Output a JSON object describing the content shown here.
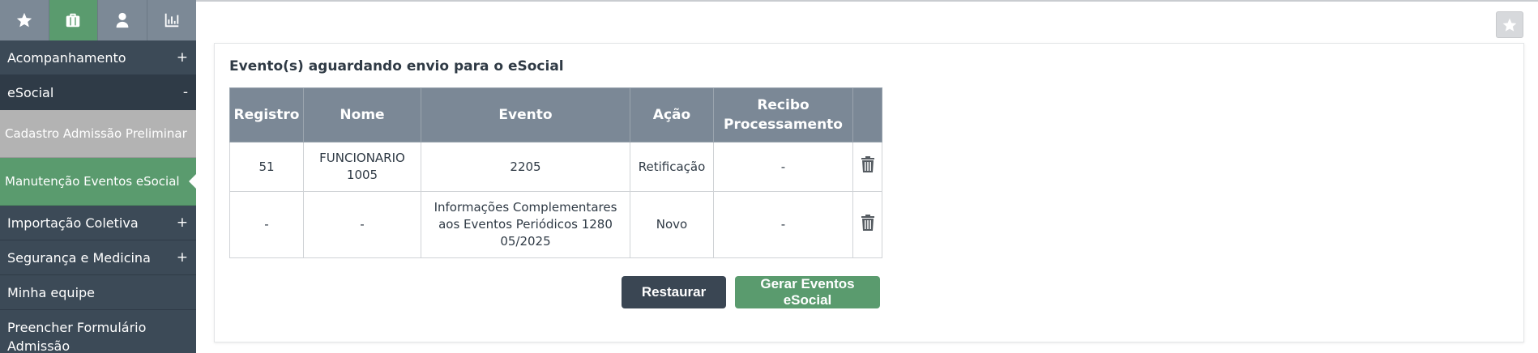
{
  "sidebar": {
    "tabs": [
      {
        "icon": "star-icon",
        "active": false
      },
      {
        "icon": "briefcase-icon",
        "active": true
      },
      {
        "icon": "user-icon",
        "active": false
      },
      {
        "icon": "bar-chart-icon",
        "active": false
      }
    ],
    "items": [
      {
        "label": "Acompanhamento",
        "sign": "+"
      },
      {
        "label": "eSocial",
        "sign": "-"
      },
      {
        "label": "Cadastro Admissão Preliminar"
      },
      {
        "label": "Manutenção Eventos eSocial"
      },
      {
        "label": "Importação Coletiva",
        "sign": "+"
      },
      {
        "label": "Segurança e Medicina",
        "sign": "+"
      },
      {
        "label": "Minha equipe"
      },
      {
        "label": "Preencher Formulário Admissão"
      }
    ]
  },
  "panel": {
    "title": "Evento(s) aguardando envio para o eSocial",
    "columns": [
      "Registro",
      "Nome",
      "Evento",
      "Ação",
      "Recibo Processamento",
      ""
    ],
    "rows": [
      {
        "registro": "51",
        "nome": "FUNCIONARIO 1005",
        "evento": "2205",
        "acao": "Retificação",
        "recibo": "-"
      },
      {
        "registro": "-",
        "nome": "-",
        "evento": "Informações Complementares aos Eventos Periódicos 1280 05/2025",
        "acao": "Novo",
        "recibo": "-"
      }
    ],
    "buttons": {
      "restore": "Restaurar",
      "generate": "Gerar Eventos eSocial"
    }
  },
  "colors": {
    "sidebar": "#3c4a57",
    "accent_green": "#5a9b6e",
    "table_header": "#7b8896"
  }
}
